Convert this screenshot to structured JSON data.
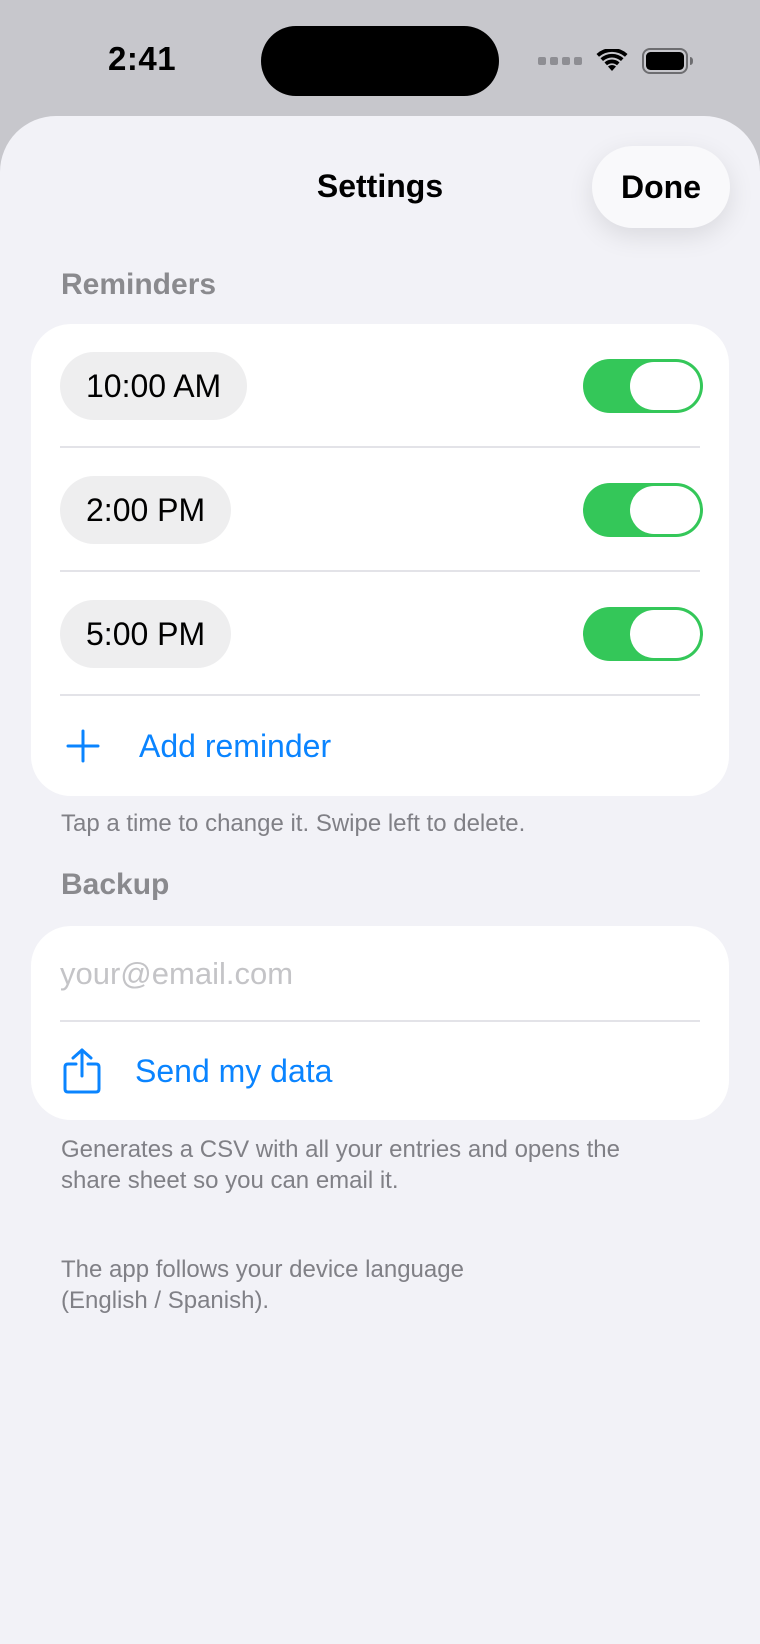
{
  "status_bar": {
    "time": "2:41",
    "icons": [
      "cellular-signal-icon",
      "wifi-icon",
      "battery-icon"
    ]
  },
  "nav": {
    "title": "Settings",
    "done_label": "Done"
  },
  "reminders": {
    "header": "Reminders",
    "items": [
      {
        "time": "10:00 AM",
        "enabled": true
      },
      {
        "time": "2:00 PM",
        "enabled": true
      },
      {
        "time": "5:00 PM",
        "enabled": true
      }
    ],
    "add_label": "Add reminder",
    "footer": "Tap a time to change it. Swipe left to delete."
  },
  "backup": {
    "header": "Backup",
    "email_placeholder": "your@email.com",
    "email_value": "",
    "send_label": "Send my data",
    "footer": "Generates a CSV with all your entries and opens the share sheet so you can email it."
  },
  "language_note": "The app follows your device language (English / Spanish).",
  "colors": {
    "accent": "#0a84ff",
    "toggle_on": "#34c759",
    "background": "#f2f2f7",
    "secondary_text": "#8a8a8e"
  }
}
